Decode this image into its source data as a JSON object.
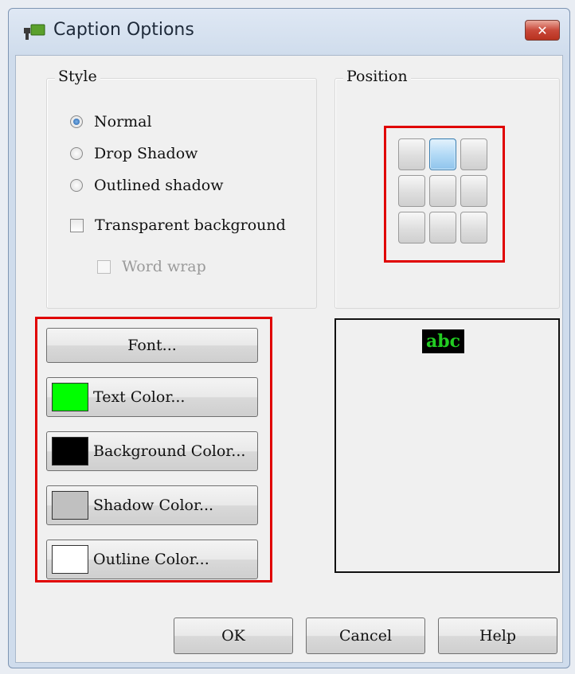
{
  "window": {
    "title": "Caption Options",
    "close_symbol": "✕"
  },
  "style_group": {
    "label": "Style",
    "options": [
      {
        "label": "Normal",
        "checked": true
      },
      {
        "label": "Drop Shadow",
        "checked": false
      },
      {
        "label": "Outlined shadow",
        "checked": false
      }
    ],
    "transparent_background": {
      "label": "Transparent background",
      "checked": false
    },
    "word_wrap": {
      "label": "Word wrap",
      "checked": false,
      "enabled": false
    }
  },
  "position_group": {
    "label": "Position",
    "selected_cell": "top-center"
  },
  "buttons": {
    "font": "Font...",
    "text_color": {
      "label": "Text Color...",
      "color": "#00ff00"
    },
    "background_color": {
      "label": "Background Color...",
      "color": "#000000"
    },
    "shadow_color": {
      "label": "Shadow Color...",
      "color": "#c0c0c0"
    },
    "outline_color": {
      "label": "Outline Color...",
      "color": "#ffffff"
    }
  },
  "preview": {
    "text": "abc",
    "text_color": "#22cc22",
    "background_color": "#000000"
  },
  "footer": {
    "ok": "OK",
    "cancel": "Cancel",
    "help": "Help"
  },
  "highlight_color": "#e00000"
}
